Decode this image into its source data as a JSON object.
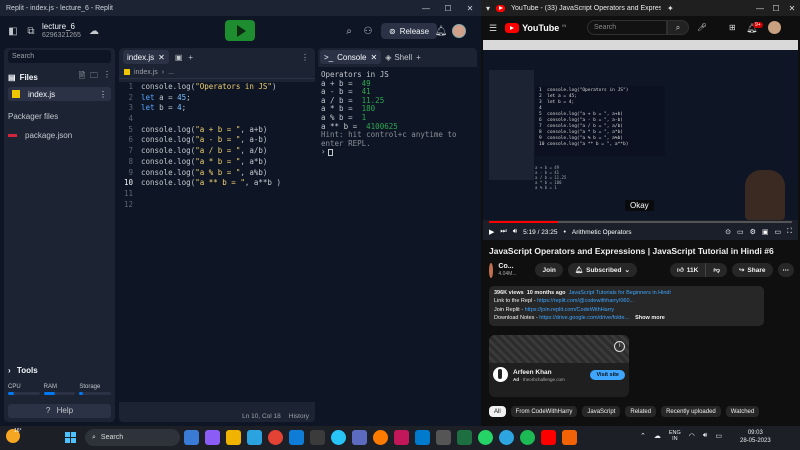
{
  "replit": {
    "window_title": "Replit - index.js - lecture_6 - Replit",
    "project_name": "lecture_6",
    "project_id": "6296321265",
    "release_label": "Release",
    "sidebar": {
      "search_placeholder": "Search",
      "files_header": "Files",
      "files": [
        "index.js"
      ],
      "packager_header": "Packager files",
      "packager_files": [
        "package.json"
      ],
      "tools_label": "Tools",
      "cpu_label": "CPU",
      "ram_label": "RAM",
      "storage_label": "Storage",
      "help_label": "Help"
    },
    "editor": {
      "tab_label": "index.js",
      "breadcrumb_file": "index.js",
      "breadcrumb_more": "...",
      "current_line": 10,
      "lines": [
        {
          "n": "1",
          "parts": [
            [
              "plain",
              "console.log("
            ],
            [
              "str",
              "\"Operators in JS\""
            ],
            [
              "plain",
              ")"
            ]
          ]
        },
        {
          "n": "2",
          "parts": [
            [
              "kw",
              "let "
            ],
            [
              "plain",
              "a = "
            ],
            [
              "num",
              "45"
            ],
            [
              "plain",
              ";"
            ]
          ]
        },
        {
          "n": "3",
          "parts": [
            [
              "kw",
              "let "
            ],
            [
              "plain",
              "b = "
            ],
            [
              "num",
              "4"
            ],
            [
              "plain",
              ";"
            ]
          ]
        },
        {
          "n": "4",
          "parts": []
        },
        {
          "n": "5",
          "parts": [
            [
              "plain",
              "console.log("
            ],
            [
              "str",
              "\"a + b = \""
            ],
            [
              "plain",
              ", a+b)"
            ]
          ]
        },
        {
          "n": "6",
          "parts": [
            [
              "plain",
              "console.log("
            ],
            [
              "str",
              "\"a - b = \""
            ],
            [
              "plain",
              ", a-b)"
            ]
          ]
        },
        {
          "n": "7",
          "parts": [
            [
              "plain",
              "console.log("
            ],
            [
              "str",
              "\"a / b = \""
            ],
            [
              "plain",
              ", a/b)"
            ]
          ]
        },
        {
          "n": "8",
          "parts": [
            [
              "plain",
              "console.log("
            ],
            [
              "str",
              "\"a * b = \""
            ],
            [
              "plain",
              ", a*b)"
            ]
          ]
        },
        {
          "n": "9",
          "parts": [
            [
              "plain",
              "console.log("
            ],
            [
              "str",
              "\"a % b = \""
            ],
            [
              "plain",
              ", a%b)"
            ]
          ]
        },
        {
          "n": "10",
          "parts": [
            [
              "plain",
              "console.log("
            ],
            [
              "str",
              "\"a ** b = \""
            ],
            [
              "plain",
              ", a**b )"
            ]
          ]
        },
        {
          "n": "11",
          "parts": []
        },
        {
          "n": "12",
          "parts": []
        }
      ],
      "status_position": "Ln 10, Col 18",
      "history_label": "History"
    },
    "console": {
      "tab_console": "Console",
      "tab_shell": "Shell",
      "header_line": "Operators in JS",
      "outputs": [
        {
          "label": "a + b =  ",
          "value": "49"
        },
        {
          "label": "a - b =  ",
          "value": "41"
        },
        {
          "label": "a / b =  ",
          "value": "11.25"
        },
        {
          "label": "a * b =  ",
          "value": "180"
        },
        {
          "label": "a % b =  ",
          "value": "1"
        },
        {
          "label": "a ** b =  ",
          "value": "4100625"
        }
      ],
      "hint": "Hint: hit control+c anytime to enter REPL."
    }
  },
  "youtube": {
    "tab_title": "YouTube - (33) JavaScript Operators and Expressio...",
    "logo_text": "YouTube",
    "logo_country": "IN",
    "search_placeholder": "Search",
    "notification_count": "9+",
    "video": {
      "caption": "Okay",
      "time": "5:19 / 23:25",
      "chapter": "Arithmetic Operators",
      "progress": 0.227,
      "inner_code": "1  console.log(\"Operators in JS\")\n2  let a = 45;\n3  let b = 4;\n4\n5  console.log(\"a + b = \", a+b)\n6  console.log(\"a - b = \", a-b)\n7  console.log(\"a / b = \", a/b)\n8  console.log(\"a * b = \", a*b)\n9  console.log(\"a % b = \", a%b)\n10 console.log(\"a ** b = \", a**b)",
      "inner_console": "a + b = 49\na - b = 41\na / b = 11.25\na * b = 180\na % b = 1"
    },
    "title": "JavaScript Operators and Expressions | JavaScript Tutorial in Hindi #6",
    "channel_name": "Co...",
    "channel_subs": "4.04M...",
    "join_label": "Join",
    "subscribed_label": "Subscribed",
    "likes": "11K",
    "share_label": "Share",
    "description": {
      "views": "396K views",
      "ago": "10 months ago",
      "playlist": "JavaScript Tutorials for Beginners in Hindi",
      "repl_text": "Link to the Repl - ",
      "repl_link": "https://replit.com/@codewithharry/060...",
      "join_text": "Join Replit - ",
      "join_link": "https://join.replit.com/CodeWithHarry",
      "notes_text": "Download Notes - ",
      "notes_link": "https://drive.google.com/drive/folde...",
      "show_more": "Show more"
    },
    "ad": {
      "name": "Arfeen Khan",
      "ad_label": "Ad",
      "domain": "theorbchallenge.com",
      "cta": "Visit site"
    },
    "chips": [
      "All",
      "From CodeWithHarry",
      "JavaScript",
      "Related",
      "Recently uploaded",
      "Watched"
    ]
  },
  "taskbar": {
    "temperature": "16°",
    "search_label": "Search",
    "lang_top": "ENG",
    "lang_bottom": "IN",
    "time": "09:03",
    "date": "28-05-2023"
  },
  "colors": {
    "replit_bg": "#0e1525",
    "replit_panel": "#1c2333",
    "run_green": "#1d8d2f",
    "console_green": "#2ea84f",
    "youtube_red": "#ff0000",
    "link_blue": "#3ea6ff"
  }
}
